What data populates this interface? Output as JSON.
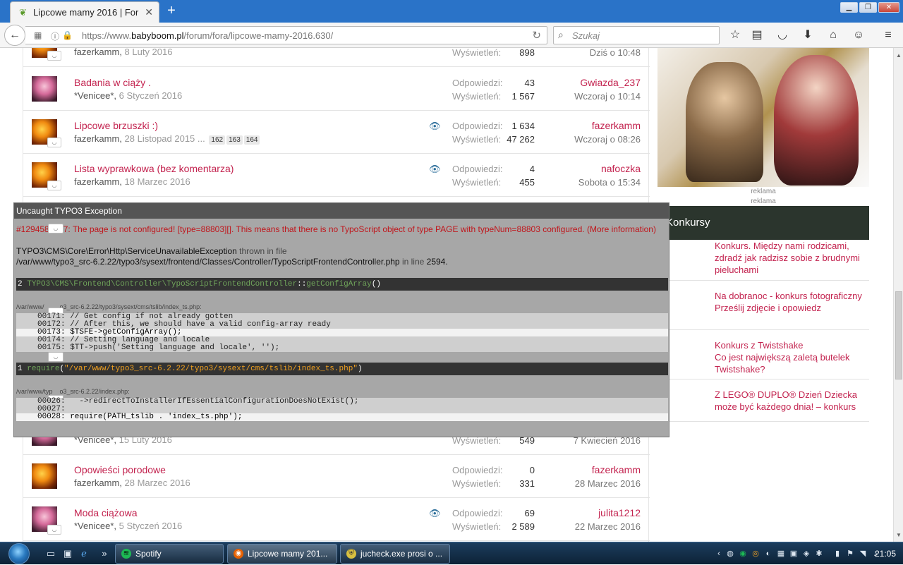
{
  "browser": {
    "tab_title": "Lipcowe mamy 2016 | Foru...",
    "url_host": "https://www.",
    "url_domain": "babyboom.pl",
    "url_path": "/forum/fora/lipcowe-mamy-2016.630/",
    "search_placeholder": "Szukaj"
  },
  "topics": [
    {
      "title": "",
      "author": "fazerkamm",
      "date": "8 Luty 2016",
      "replies_label": "",
      "replies": "",
      "views_label": "Wyświetleń:",
      "views": "898",
      "last_user": "",
      "last_date": "Dziś o 10:48",
      "avatar": "fire",
      "watched": false
    },
    {
      "title": "Badania w ciąży .",
      "author": "*Venicee*",
      "date": "6 Styczeń 2016",
      "replies_label": "Odpowiedzi:",
      "replies": "43",
      "views_label": "Wyświetleń:",
      "views": "1 567",
      "last_user": "Gwiazda_237",
      "last_date": "Wczoraj o 10:14",
      "avatar": "girl",
      "watched": false
    },
    {
      "title": "Lipcowe brzuszki :)",
      "author": "fazerkamm",
      "date": "28 Listopad 2015",
      "pages_sep": "...",
      "pages": [
        "162",
        "163",
        "164"
      ],
      "replies_label": "Odpowiedzi:",
      "replies": "1 634",
      "views_label": "Wyświetleń:",
      "views": "47 262",
      "last_user": "fazerkamm",
      "last_date": "Wczoraj o 08:26",
      "avatar": "fire",
      "watched": true
    },
    {
      "title": "Lista wyprawkowa (bez komentarza)",
      "author": "fazerkamm",
      "date": "18 Marzec 2016",
      "replies_label": "Odpowiedzi:",
      "replies": "4",
      "views_label": "Wyświetleń:",
      "views": "455",
      "last_user": "nafoczka",
      "last_date": "Sobota o 15:34",
      "avatar": "fire",
      "watched": true
    },
    {
      "title": "",
      "author": "*Venicee*",
      "date": "15 Luty 2016",
      "replies_label": "",
      "replies": "",
      "views_label": "Wyświetleń:",
      "views": "549",
      "last_user": "",
      "last_date": "7 Kwiecień 2016",
      "avatar": "girl",
      "watched": false
    },
    {
      "title": "Opowieści porodowe",
      "author": "fazerkamm",
      "date": "28 Marzec 2016",
      "replies_label": "Odpowiedzi:",
      "replies": "0",
      "views_label": "Wyświetleń:",
      "views": "331",
      "last_user": "fazerkamm",
      "last_date": "28 Marzec 2016",
      "avatar": "fire",
      "watched": false
    },
    {
      "title": "Moda ciążowa",
      "author": "*Venicee*",
      "date": "5 Styczeń 2016",
      "replies_label": "Odpowiedzi:",
      "replies": "69",
      "views_label": "Wyświetleń:",
      "views": "2 589",
      "last_user": "julita1212",
      "last_date": "22 Marzec 2016",
      "avatar": "girl",
      "watched": true
    }
  ],
  "sidebar": {
    "ad_label_1": "reklama",
    "ad_label_2": "reklama",
    "konkursy_title": "Konkursy",
    "konkursy": [
      "Konkurs. Między nami rodzicami, zdradź jak radzisz sobie z brudnymi pieluchami",
      "Na dobranoc - konkurs fotograficzny\nPrześlij zdjęcie i opowiedz",
      "Konkurs z Twistshake\nCo jest największą zaletą butelek Twistshake?",
      "Z LEGO® DUPLO® Dzień Dziecka może być każdego dnia! – konkurs"
    ]
  },
  "exception": {
    "header": "Uncaught TYPO3 Exception",
    "message_pre": "#129458",
    "message_post": "7: The page is not configured! [type=88803][]. This means that there is no TypoScript object of type PAGE with typeNum=88803 configured.",
    "more_info": "(More information)",
    "class_name": "TYPO3\\CMS\\Core\\Error\\Http\\ServiceUnavailableException",
    "thrown_in": "thrown in file",
    "file": "/var/www/typo3_src-6.2.22/typo3/sysext/frontend/Classes/Controller/TypoScriptFrontendController.php",
    "in_line": "in line",
    "line": "2594",
    "trace2_num": "2",
    "trace2_class": "TYPO3\\CMS\\Frontend\\Controller\\TypoScriptFrontendController",
    "trace2_sep": "::",
    "trace2_method": "getConfigArray",
    "trace2_args": "()",
    "trace2_file_a": "/var/www/",
    "trace2_file_b": "o3_src-6.2.22/typo3/sysext/cms/tslib/index_ts.php:",
    "code1": [
      "00171: // Get config if not already gotten",
      "00172: // After this, we should have a valid config-array ready",
      "00173: $TSFE->getConfigArray();",
      "00174: // Setting language and locale",
      "00175: $TT->push('Setting language and locale', '');"
    ],
    "trace1_num": "1",
    "trace1_fn": "require",
    "trace1_arg": "\"/var/www/typo3_src-6.2.22/typo3/sysext/cms/tslib/index_ts.php\"",
    "trace1_file_a": "/var/www/typ",
    "trace1_file_b": "o3_src-6.2.22/index.php:",
    "code2": [
      "00026:   ->redirectToInstallerIfEssentialConfigurationDoesNotExist();",
      "00027:",
      "00028: require(PATH_tslib . 'index_ts.php');"
    ]
  },
  "taskbar": {
    "items": [
      "Spotify",
      "Lipcowe mamy 201...",
      "jucheck.exe prosi o ..."
    ],
    "clock": "21:05"
  }
}
